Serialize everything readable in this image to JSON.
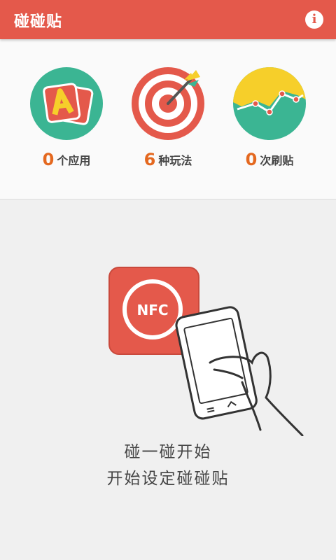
{
  "app": {
    "title": "碰碰贴"
  },
  "header": {
    "info_icon": "info-icon",
    "info_glyph": "i"
  },
  "stats": [
    {
      "icon": "apps-cards-icon",
      "number": "0",
      "label": "个应用"
    },
    {
      "icon": "target-dart-icon",
      "number": "6",
      "label": "种玩法"
    },
    {
      "icon": "line-chart-icon",
      "number": "0",
      "label": "次刷贴"
    }
  ],
  "nfc": {
    "badge_text": "NFC",
    "icon": "nfc-phone-tap-icon"
  },
  "message": {
    "line1": "碰一碰开始",
    "line2": "开始设定碰碰贴"
  },
  "colors": {
    "brand_red": "#e4594b",
    "accent_orange": "#e4681f",
    "teal": "#3bb593",
    "yellow": "#f6cf2a"
  }
}
